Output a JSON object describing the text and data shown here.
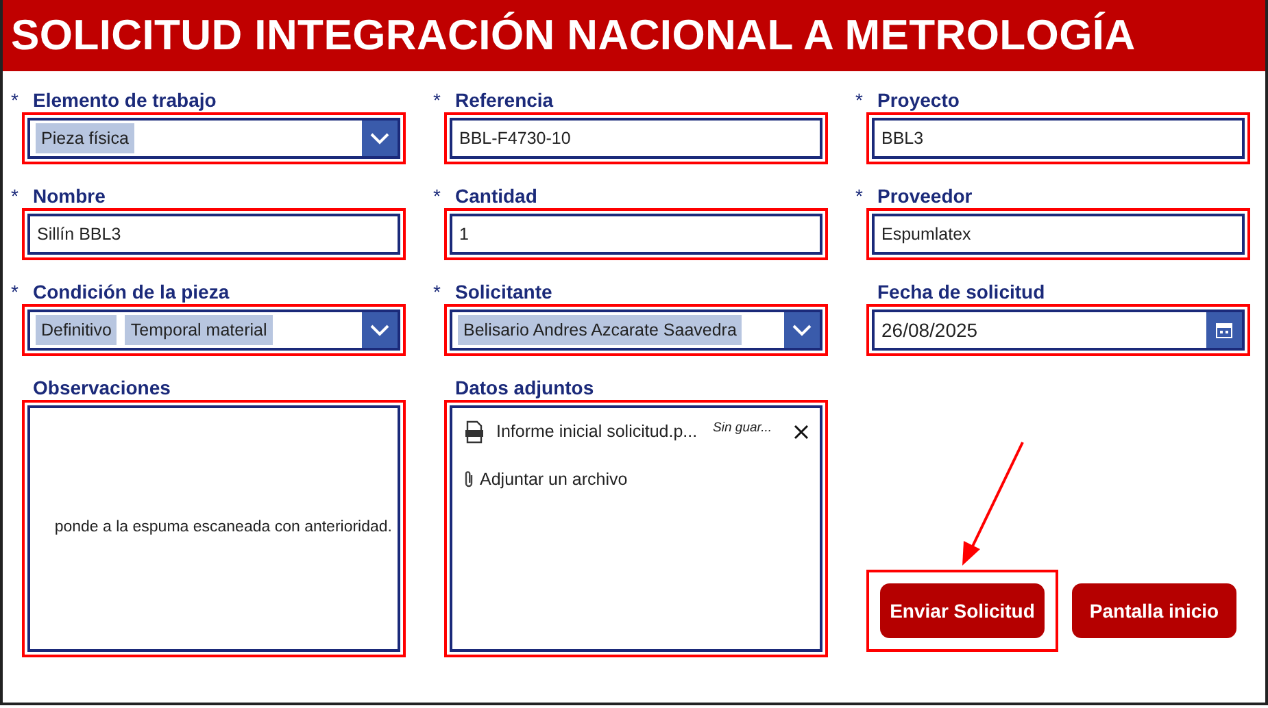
{
  "title": "SOLICITUD INTEGRACIÓN NACIONAL A METROLOGÍA",
  "fields": [
    {
      "kind": "dropdown",
      "label": "Elemento de trabajo",
      "marker": "*",
      "highlighted": true,
      "chips": [
        "Pieza física"
      ]
    },
    {
      "kind": "text",
      "label": "Referencia",
      "marker": "*",
      "highlighted": true,
      "value": "BBL-F4730-10"
    },
    {
      "kind": "text",
      "label": "Proyecto",
      "marker": "*",
      "highlighted": true,
      "value": "BBL3"
    },
    {
      "kind": "text",
      "label": "Nombre",
      "marker": "*",
      "highlighted": true,
      "value": "Sillín BBL3"
    },
    {
      "kind": "text",
      "label": "Cantidad",
      "marker": "*",
      "highlighted": true,
      "value": "1"
    },
    {
      "kind": "text",
      "label": "Proveedor",
      "marker": "*",
      "highlighted": true,
      "value": "Espumlatex"
    },
    {
      "kind": "dropdown",
      "label": "Condición de la pieza",
      "marker": "*",
      "highlighted": true,
      "chips": [
        "Definitivo",
        "Temporal material"
      ]
    },
    {
      "kind": "dropdown",
      "label": "Solicitante",
      "marker": "*",
      "highlighted": true,
      "chips": [
        "Belisario Andres Azcarate Saavedra"
      ]
    },
    {
      "kind": "date",
      "label": "Fecha de solicitud",
      "highlighted": true,
      "value": "26/08/2025"
    }
  ],
  "observations": {
    "label": "Observaciones",
    "highlighted": true,
    "value": "ponde a la espuma escaneada con anterioridad."
  },
  "attachments": {
    "label": "Datos adjuntos",
    "highlighted": true,
    "files": [
      {
        "name": "Informe inicial solicitud.p...",
        "status": "Sin guar..."
      }
    ],
    "add_label": "Adjuntar un archivo"
  },
  "buttons": [
    {
      "label": "Enviar Solicitud",
      "highlighted": true,
      "pointed": true
    },
    {
      "label": "Pantalla inicio",
      "highlighted": false,
      "pointed": false
    }
  ]
}
